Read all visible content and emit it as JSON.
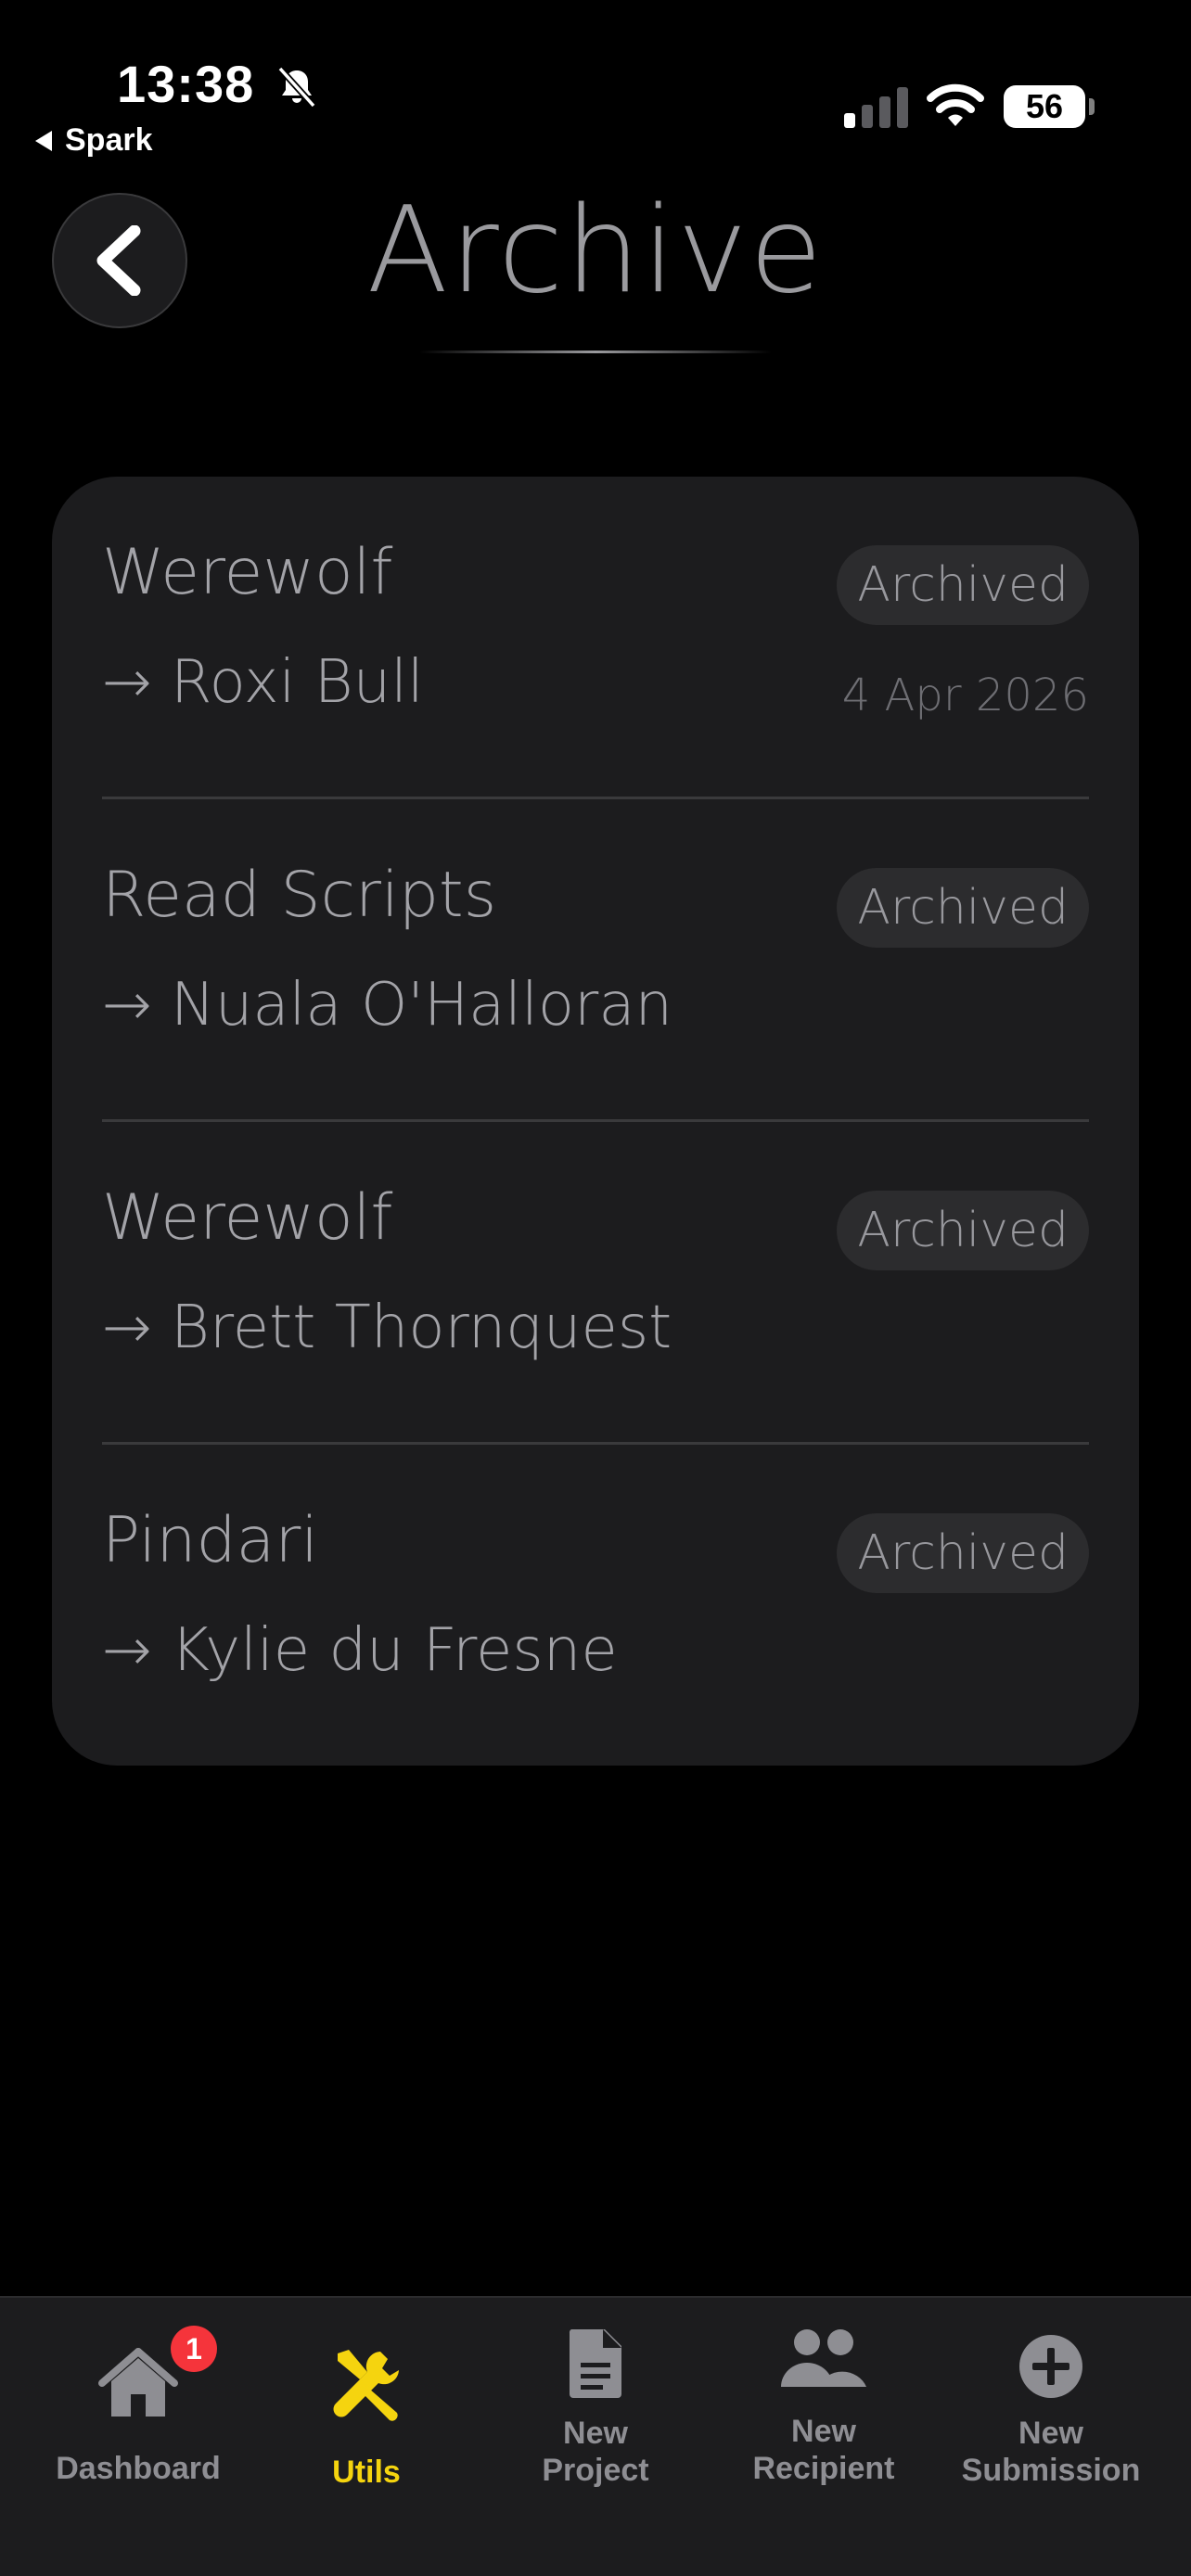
{
  "status_bar": {
    "time": "13:38",
    "back_app": "Spark",
    "battery": "56"
  },
  "header": {
    "title": "Archive"
  },
  "archive_items": [
    {
      "project": "Werewolf",
      "recipient": "→ Roxi Bull",
      "status": "Archived",
      "date": "4 Apr 2026"
    },
    {
      "project": "Read Scripts",
      "recipient": "→ Nuala O'Halloran",
      "status": "Archived",
      "date": ""
    },
    {
      "project": "Werewolf",
      "recipient": "→ Brett Thornquest",
      "status": "Archived",
      "date": ""
    },
    {
      "project": "Pindari",
      "recipient": "→ Kylie du Fresne",
      "status": "Archived",
      "date": ""
    }
  ],
  "tab_bar": {
    "dashboard": {
      "label": "Dashboard",
      "badge": "1",
      "icon": "house-icon"
    },
    "utils": {
      "label": "Utils",
      "icon": "wrench-screwdriver-icon"
    },
    "new_project": {
      "label": "New\nProject",
      "icon": "document-icon"
    },
    "new_recipient": {
      "label": "New\nRecipient",
      "icon": "people-icon"
    },
    "new_submission": {
      "label": "New\nSubmission",
      "icon": "plus-circle-icon"
    }
  },
  "colors": {
    "background": "#000000",
    "card": "#1c1c1e",
    "accent": "#f5d40f",
    "badge": "#f5343b"
  }
}
